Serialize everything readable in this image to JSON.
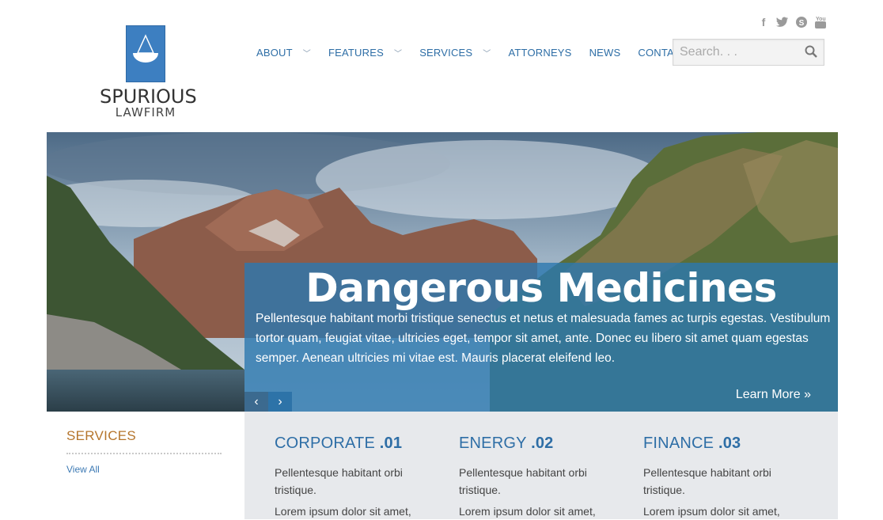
{
  "logo": {
    "name": "SPURIOUS",
    "sub": "LAWFIRM"
  },
  "social": [
    {
      "icon": "facebook-icon",
      "glyph": "f"
    },
    {
      "icon": "twitter-icon",
      "glyph": "t"
    },
    {
      "icon": "skype-icon",
      "glyph": "S"
    },
    {
      "icon": "youtube-icon",
      "glyph": "▶"
    }
  ],
  "nav": [
    {
      "label": "ABOUT",
      "dropdown": true
    },
    {
      "label": "FEATURES",
      "dropdown": true
    },
    {
      "label": "SERVICES",
      "dropdown": true
    },
    {
      "label": "ATTORNEYS",
      "dropdown": false
    },
    {
      "label": "NEWS",
      "dropdown": false
    },
    {
      "label": "CONTACT",
      "dropdown": false
    }
  ],
  "search": {
    "placeholder": "Search. . ."
  },
  "hero": {
    "title": "Dangerous Medicines",
    "text": "Pellentesque habitant morbi tristique senectus et netus et malesuada fames ac turpis egestas. Vestibulum tortor quam, feugiat vitae, ultricies eget, tempor sit amet, ante. Donec eu libero sit amet quam egestas semper. Aenean ultricies mi vitae est. Mauris placerat eleifend leo.",
    "learn_more": "Learn More »",
    "prev": "‹",
    "next": "›"
  },
  "sidebar": {
    "title": "SERVICES",
    "link": "View All"
  },
  "services": [
    {
      "name": "CORPORATE",
      "num": ".01",
      "line1": "Pellentesque habitant orbi tristique.",
      "line2": "Lorem ipsum dolor sit amet,"
    },
    {
      "name": "ENERGY",
      "num": ".02",
      "line1": "Pellentesque habitant orbi tristique.",
      "line2": "Lorem ipsum dolor sit amet,"
    },
    {
      "name": "FINANCE",
      "num": ".03",
      "line1": "Pellentesque habitant orbi tristique.",
      "line2": "Lorem ipsum dolor sit amet,"
    }
  ],
  "colors": {
    "brand_blue": "#3d7fc1",
    "accent_orange": "#b5752c",
    "panel_gray": "#e7e9ec"
  }
}
